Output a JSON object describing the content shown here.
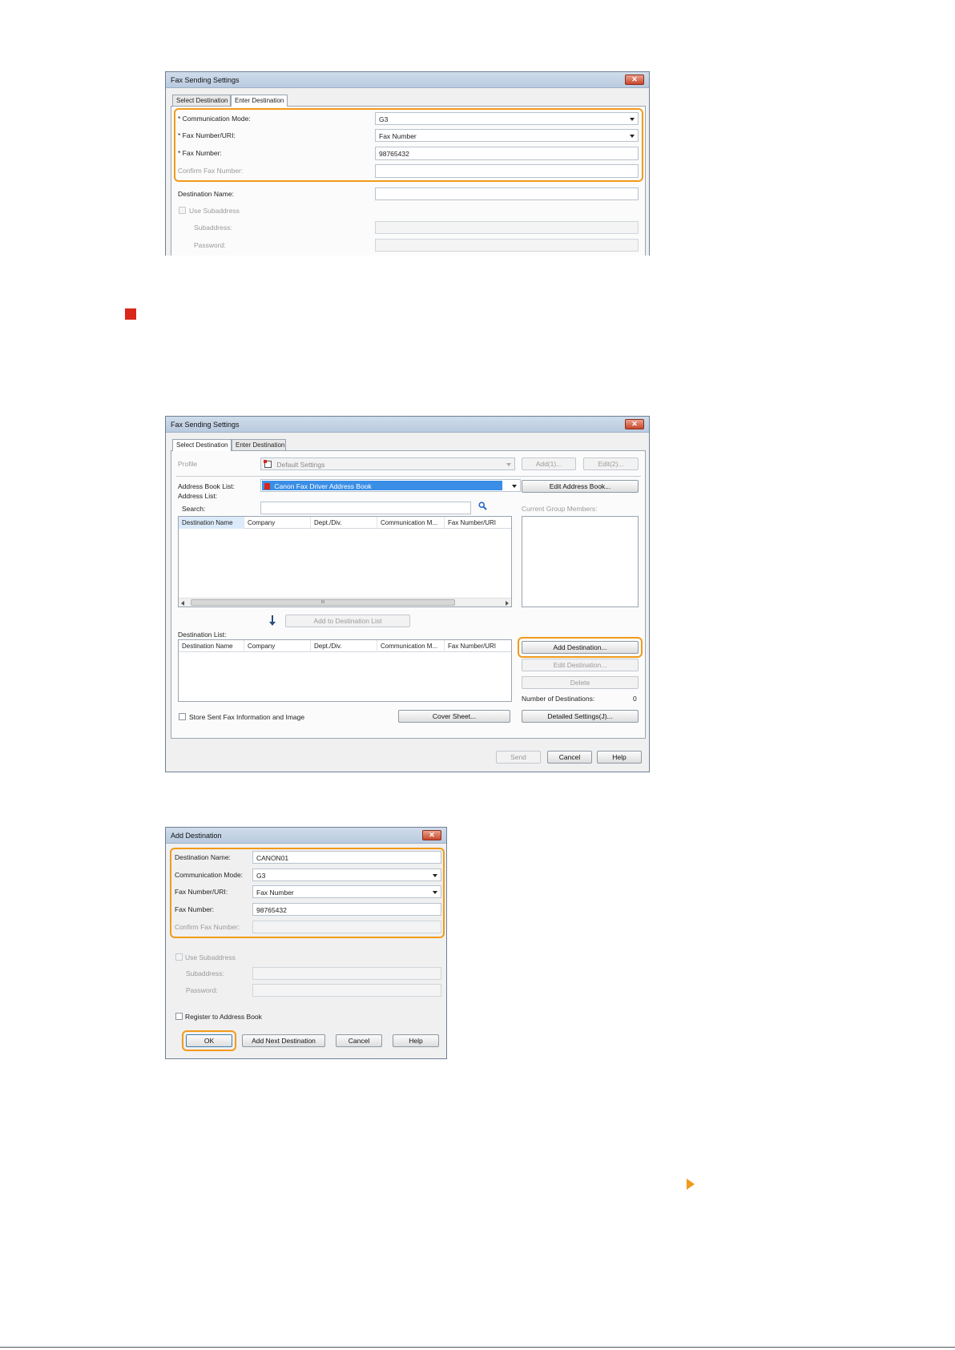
{
  "fig1": {
    "title": "Fax Sending Settings",
    "close_label": "✕",
    "tabs": [
      "Select Destination",
      "Enter Destination"
    ],
    "communication_mode_label": "* Communication Mode:",
    "communication_mode_value": "G3",
    "fax_number_uri_label": "* Fax Number/URI:",
    "fax_number_uri_value": "Fax Number",
    "fax_number_label": "* Fax Number:",
    "fax_number_value": "98765432",
    "confirm_fax_number_label": "Confirm Fax Number:",
    "destination_name_label": "Destination Name:",
    "use_subaddress_label": "Use Subaddress",
    "subaddress_label": "Subaddress:",
    "password_label": "Password:"
  },
  "bullet_color": "#d9271c",
  "highlight_color": "#f29a1a",
  "fig2": {
    "title": "Fax Sending Settings",
    "close_label": "✕",
    "tabs": [
      "Select Destination",
      "Enter Destination"
    ],
    "profile_label": "Profile",
    "profile_value": "Default Settings",
    "add_button": "Add(1)...",
    "edit_button": "Edit(2)...",
    "address_book_list_label": "Address Book List:",
    "address_book_value": "Canon Fax Driver Address Book",
    "edit_address_book_button": "Edit Address Book...",
    "address_list_label": "Address List:",
    "search_label": "Search:",
    "current_group_members_label": "Current Group Members:",
    "columns": [
      "Destination Name",
      "Company",
      "Dept./Div.",
      "Communication M...",
      "Fax Number/URI"
    ],
    "scroll_thumb_mark": "III",
    "add_to_destination_list_button": "Add to Destination List",
    "destination_list_label": "Destination List:",
    "add_destination_button": "Add Destination...",
    "edit_destination_button": "Edit Destination...",
    "delete_button": "Delete",
    "number_of_destinations_label": "Number of Destinations:",
    "number_of_destinations_value": "0",
    "store_sent_fax_label": "Store Sent Fax Information and Image",
    "cover_sheet_button": "Cover Sheet...",
    "detailed_settings_button": "Detailed Settings(J)...",
    "send_button": "Send",
    "cancel_button": "Cancel",
    "help_button": "Help"
  },
  "fig3": {
    "title": "Add Destination",
    "close_label": "✕",
    "destination_name_label": "Destination Name:",
    "destination_name_value": "CANON01",
    "communication_mode_label": "Communication Mode:",
    "communication_mode_value": "G3",
    "fax_number_uri_label": "Fax Number/URI:",
    "fax_number_uri_value": "Fax Number",
    "fax_number_label": "Fax Number:",
    "fax_number_value": "98765432",
    "confirm_fax_number_label": "Confirm Fax Number:",
    "use_subaddress_label": "Use Subaddress",
    "subaddress_label": "Subaddress:",
    "password_label": "Password:",
    "register_label": "Register to Address Book",
    "ok_button": "OK",
    "add_next_destination_button": "Add Next Destination",
    "cancel_button": "Cancel",
    "help_button": "Help"
  }
}
